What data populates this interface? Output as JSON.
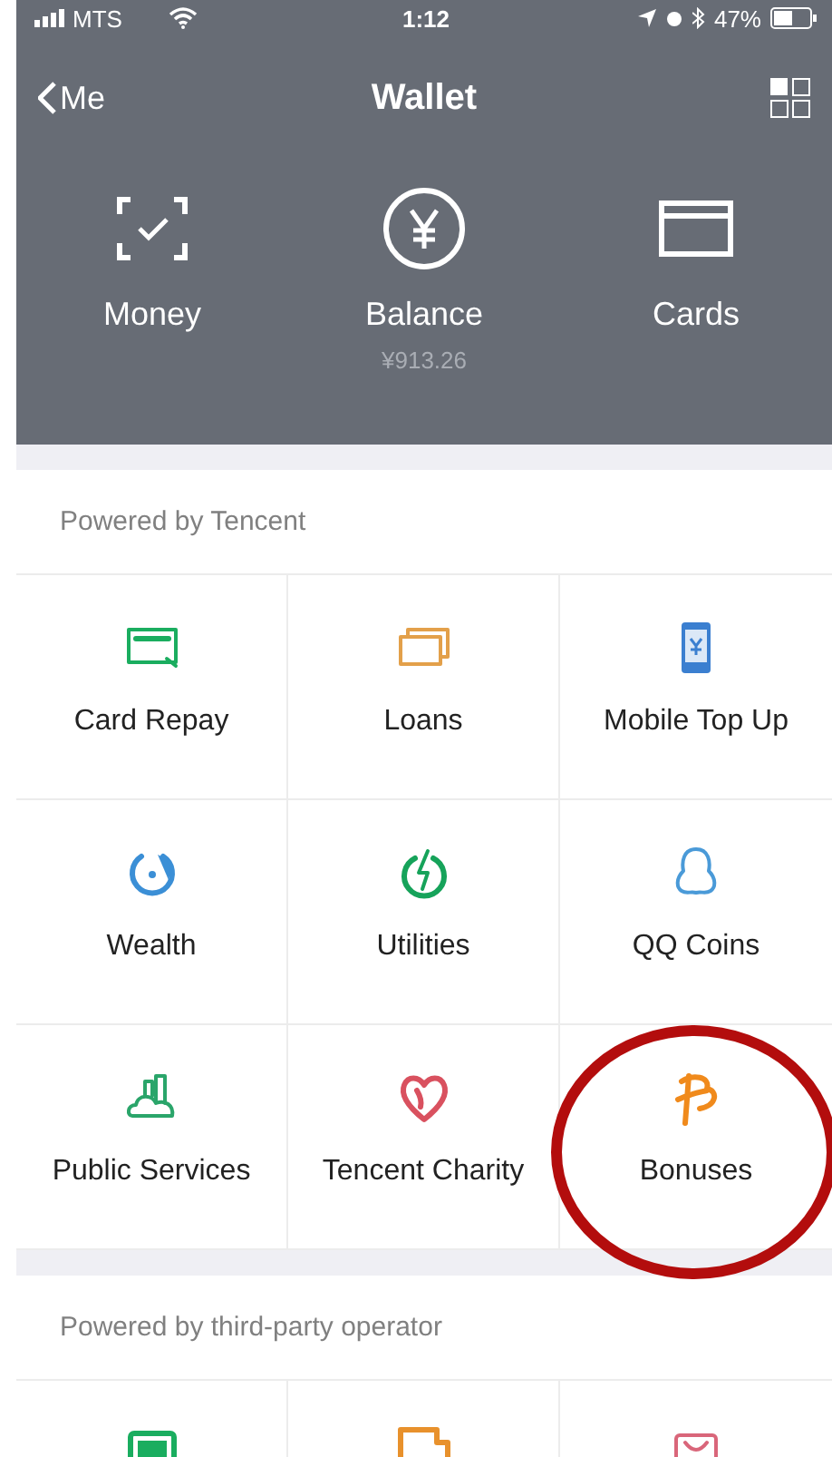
{
  "status_bar": {
    "carrier": "MTS",
    "time": "1:12",
    "battery": "47%"
  },
  "nav": {
    "back": "Me",
    "title": "Wallet"
  },
  "actions": [
    {
      "kind": "scan",
      "label": "Money"
    },
    {
      "kind": "yen",
      "label": "Balance",
      "sub": "¥913.26"
    },
    {
      "kind": "card",
      "label": "Cards"
    }
  ],
  "sections": [
    {
      "title": "Powered by Tencent",
      "tiles": [
        {
          "kind": "card-repay",
          "label": "Card Repay",
          "color": "#1aad5f",
          "circled": false
        },
        {
          "kind": "loans",
          "label": "Loans",
          "color": "#e3a04a",
          "circled": false
        },
        {
          "kind": "phone",
          "label": "Mobile Top Up",
          "color": "#3b7fd0",
          "circled": false
        },
        {
          "kind": "wealth",
          "label": "Wealth",
          "color": "#3b8fd6",
          "circled": false
        },
        {
          "kind": "utilities",
          "label": "Utilities",
          "color": "#16a35a",
          "circled": false
        },
        {
          "kind": "penguin",
          "label": "QQ Coins",
          "color": "#4a9ad8",
          "circled": false
        },
        {
          "kind": "city",
          "label": "Public Services",
          "color": "#2aa56a",
          "circled": false
        },
        {
          "kind": "heart",
          "label": "Tencent Charity",
          "color": "#d9515f",
          "circled": false
        },
        {
          "kind": "bonus",
          "label": "Bonuses",
          "color": "#f08a1c",
          "circled": true
        }
      ]
    },
    {
      "title": "Powered by third-party operator",
      "tiles": [
        {
          "kind": "screen",
          "color": "#1aad5f",
          "circled": false
        },
        {
          "kind": "box",
          "color": "#e8912c",
          "circled": false
        },
        {
          "kind": "bag",
          "color": "#d9667a",
          "circled": false
        }
      ]
    }
  ]
}
